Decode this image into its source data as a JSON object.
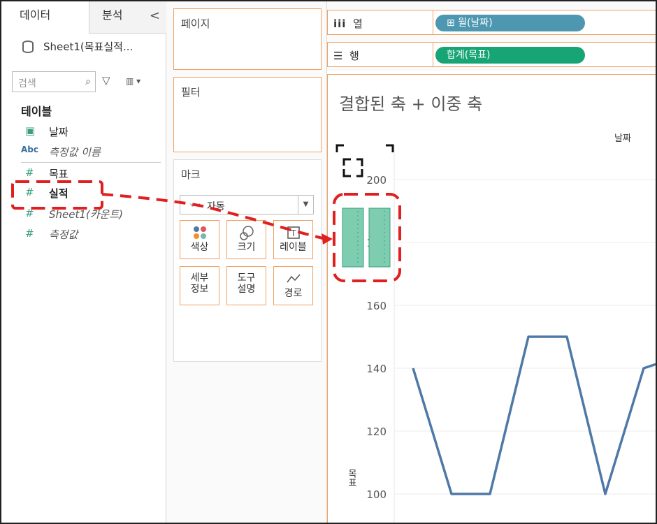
{
  "sidebar": {
    "tab_data": "데이터",
    "tab_analysis": "분석",
    "collapse_icon": "◁",
    "datasource": "Sheet1(목표실적...",
    "search_placeholder": "검색",
    "tables_header": "테이블",
    "fields": [
      {
        "icon": "calendar-icon",
        "icon_text": "📅",
        "label": "날짜",
        "italic": false
      },
      {
        "icon": "abc-icon",
        "icon_text": "Abc",
        "label": "측정값 이름",
        "italic": true
      },
      {
        "icon": "hash-icon",
        "icon_text": "#",
        "label": "목표",
        "italic": false
      },
      {
        "icon": "hash-icon",
        "icon_text": "#",
        "label": "실적",
        "italic": false
      },
      {
        "icon": "hash-icon",
        "icon_text": "#",
        "label": "Sheet1(카운트)",
        "italic": true
      },
      {
        "icon": "hash-icon",
        "icon_text": "#",
        "label": "측정값",
        "italic": true
      }
    ]
  },
  "shelves": {
    "pages": "페이지",
    "filters": "필터",
    "marks": "마크",
    "marks_type": "자동",
    "buttons": [
      {
        "label": "색상",
        "icon": "color-dots-icon"
      },
      {
        "label": "크기",
        "icon": "size-circles-icon"
      },
      {
        "label": "레이블",
        "icon": "label-t-icon"
      },
      {
        "label": "세부\n정보",
        "icon": "detail-icon"
      },
      {
        "label": "도구\n설명",
        "icon": "tooltip-icon"
      },
      {
        "label": "경로",
        "icon": "path-icon"
      }
    ]
  },
  "columns": {
    "icon_text": "iii",
    "label": "열",
    "pill": "⊞ 월(날짜)",
    "pill_color": "#4d97b0"
  },
  "rows": {
    "icon_text": "☰",
    "label": "행",
    "pill": "합계(목표)",
    "pill_color": "#17a576"
  },
  "viz": {
    "title": "결합된 축 + 이중 축",
    "date_header": "날짜",
    "measure_axis_name": "목표"
  },
  "chart_data": {
    "type": "line",
    "title": "결합된 축 + 이중 축",
    "xlabel": "날짜",
    "ylabel": "목표",
    "ylim": [
      100,
      205
    ],
    "yticks": [
      200,
      180,
      160,
      140,
      120,
      100
    ],
    "x": [
      1,
      2,
      3,
      4,
      5,
      6,
      7,
      8
    ],
    "series": [
      {
        "values": [
          140,
          100,
          100,
          150,
          150,
          100,
          140,
          144
        ]
      }
    ],
    "line_color": "#4e79a7",
    "grid": true
  },
  "annotation": {
    "color": "#e02020",
    "style": "dashed"
  }
}
